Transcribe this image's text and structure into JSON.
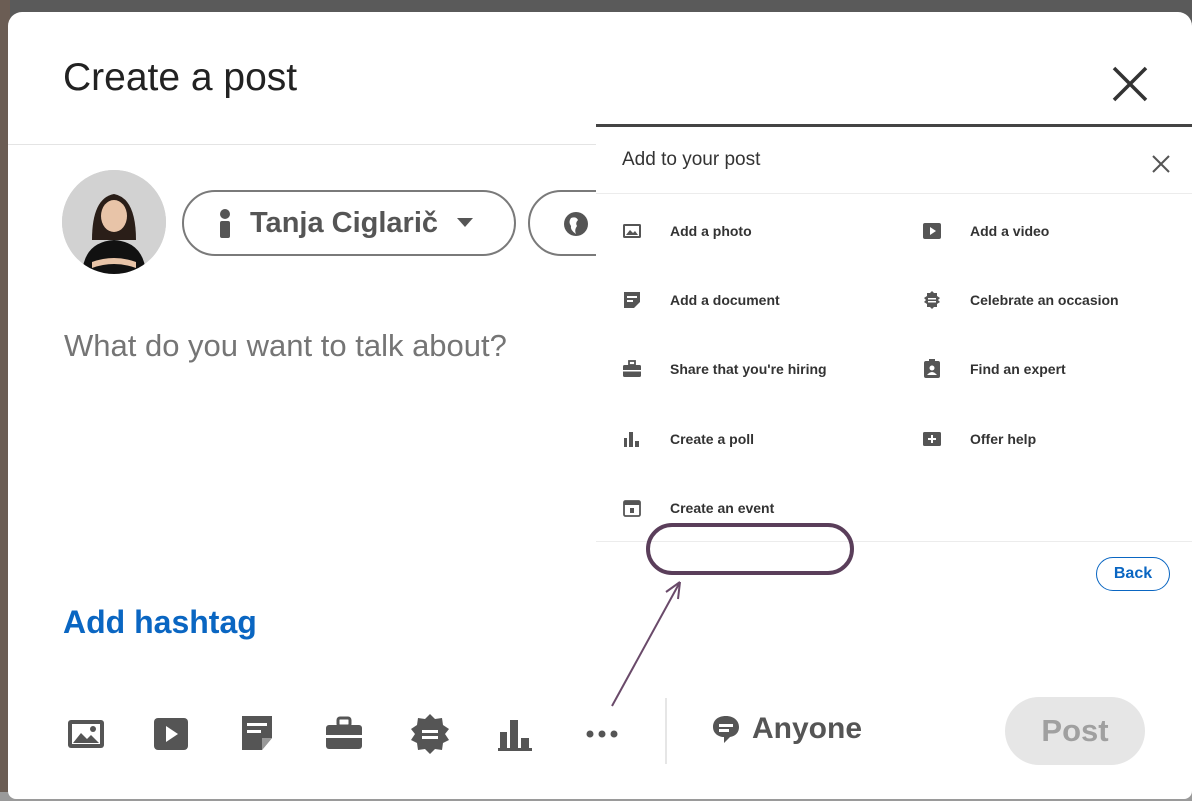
{
  "modal": {
    "title": "Create a post",
    "author": {
      "name": "Tanja Ciglarič"
    },
    "input": {
      "placeholder": "What do you want to talk about?"
    },
    "add_hashtag_label": "Add hashtag",
    "toolbar": {
      "icons": [
        "photo-icon",
        "video-icon",
        "document-icon",
        "job-icon",
        "celebrate-icon",
        "poll-icon",
        "more-icon"
      ],
      "audience_label": "Anyone",
      "post_label": "Post"
    }
  },
  "panel": {
    "title": "Add to your post",
    "items": [
      {
        "label": "Add a photo",
        "icon": "photo-icon"
      },
      {
        "label": "Add a video",
        "icon": "video-icon"
      },
      {
        "label": "Add a document",
        "icon": "document-icon"
      },
      {
        "label": "Celebrate an occasion",
        "icon": "celebrate-icon"
      },
      {
        "label": "Share that you're hiring",
        "icon": "briefcase-icon"
      },
      {
        "label": "Find an expert",
        "icon": "expert-icon"
      },
      {
        "label": "Create a poll",
        "icon": "poll-icon"
      },
      {
        "label": "Offer help",
        "icon": "offer-help-icon"
      },
      {
        "label": "Create an event",
        "icon": "calendar-icon"
      }
    ],
    "back_label": "Back"
  },
  "colors": {
    "accent": "#0a66c2",
    "highlight": "#5a3e5a",
    "disabled_bg": "#e6e6e6"
  }
}
